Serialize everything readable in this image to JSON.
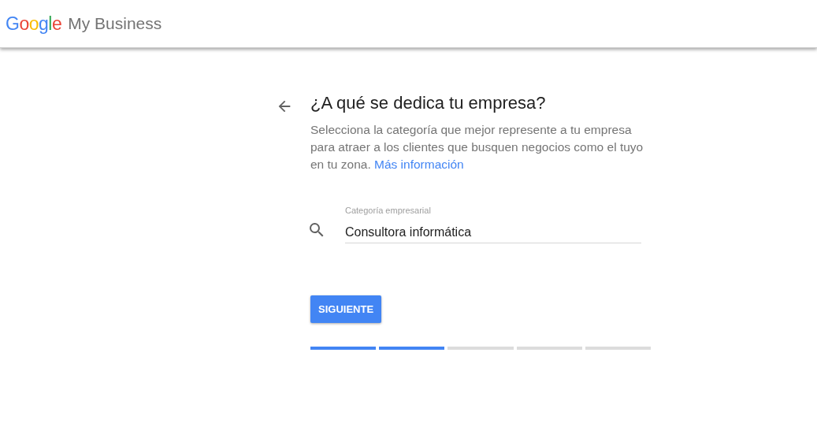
{
  "header": {
    "logo": "Google",
    "product": "My Business"
  },
  "question": {
    "title": "¿A qué se dedica tu empresa?",
    "description": "Selecciona la categoría que mejor represente a tu empresa para atraer a los clientes que busquen negocios como el tuyo en tu zona.",
    "link": "Más información"
  },
  "field": {
    "label": "Categoría empresarial",
    "value": "Consultora informática"
  },
  "button": "SIGUIENTE",
  "steps": [
    {
      "complete": true
    },
    {
      "complete": true
    },
    {
      "complete": false
    },
    {
      "complete": false
    },
    {
      "complete": false
    }
  ]
}
